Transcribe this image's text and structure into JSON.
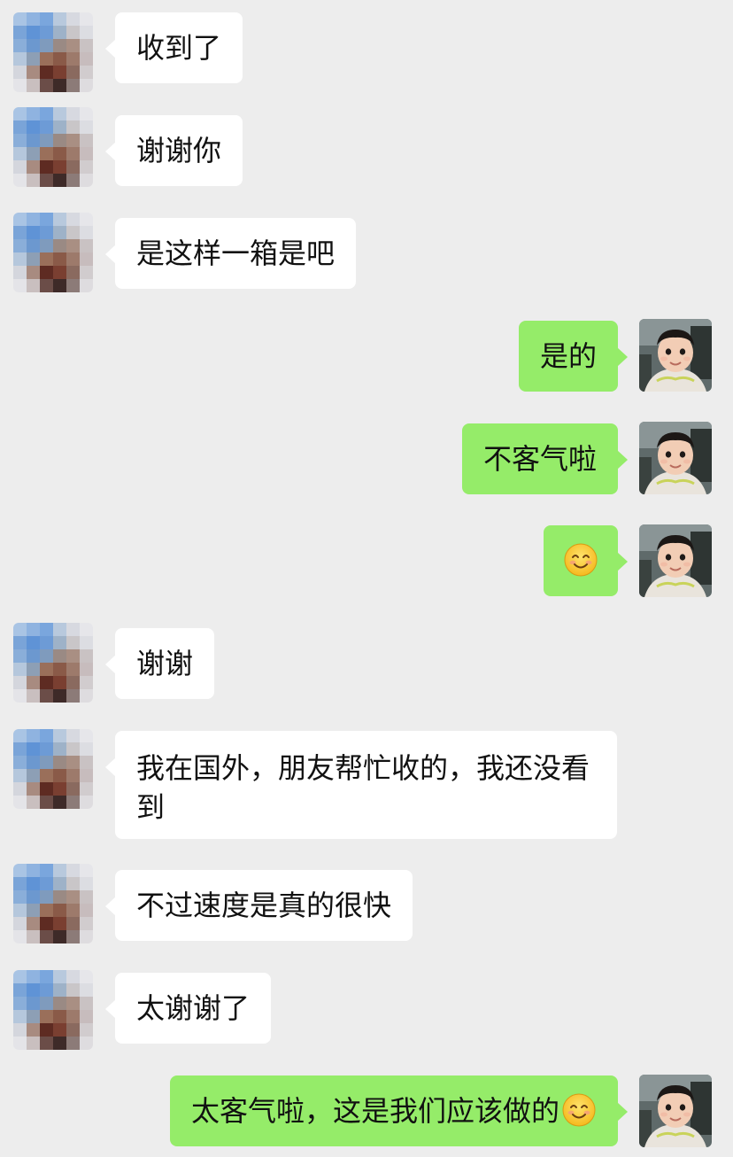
{
  "messages": [
    {
      "side": "left",
      "text": "收到了"
    },
    {
      "side": "left",
      "text": "谢谢你"
    },
    {
      "side": "left",
      "text": "是这样一箱是吧"
    },
    {
      "side": "right",
      "text": "是的"
    },
    {
      "side": "right",
      "text": "不客气啦"
    },
    {
      "side": "right",
      "text": "",
      "emoji": "smiling-face-emoji"
    },
    {
      "side": "left",
      "text": "谢谢"
    },
    {
      "side": "left",
      "text": "我在国外，朋友帮忙收的，我还没看到"
    },
    {
      "side": "left",
      "text": "不过速度是真的很快"
    },
    {
      "side": "left",
      "text": "太谢谢了"
    },
    {
      "side": "right",
      "text": "太客气啦，这是我们应该做的",
      "emoji": "smiling-face-emoji"
    }
  ],
  "colors": {
    "background": "#ededed",
    "incoming_bubble": "#ffffff",
    "outgoing_bubble": "#95ec69",
    "text": "#111111"
  },
  "icons": {
    "incoming_avatar": "pixelated-avatar",
    "outgoing_avatar": "baby-photo-avatar",
    "emoji": "smiling-face-emoji"
  }
}
